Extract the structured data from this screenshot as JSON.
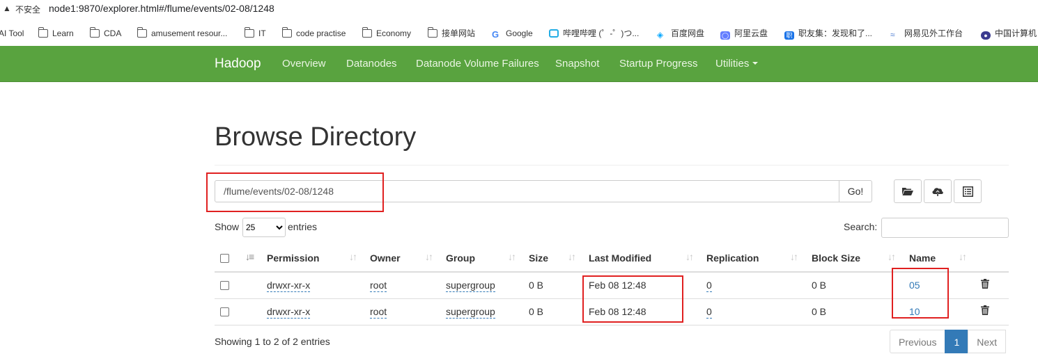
{
  "browser": {
    "warning_label": "不安全",
    "url": "node1:9870/explorer.html#/flume/events/02-08/1248"
  },
  "bookmarks": [
    {
      "label": "AI Tool",
      "icon": "none"
    },
    {
      "label": "Learn",
      "icon": "folder-icon"
    },
    {
      "label": "CDA",
      "icon": "folder-icon"
    },
    {
      "label": "amusement resour...",
      "icon": "folder-icon"
    },
    {
      "label": "IT",
      "icon": "folder-icon"
    },
    {
      "label": "code practise",
      "icon": "folder-icon"
    },
    {
      "label": "Economy",
      "icon": "folder-icon"
    },
    {
      "label": "接单网站",
      "icon": "folder-icon"
    },
    {
      "label": "Google",
      "icon": "google-icon"
    },
    {
      "label": "哔哩哔哩 (゜-゜)つ...",
      "icon": "bilibili-icon"
    },
    {
      "label": "百度网盘",
      "icon": "baidu-pan-icon"
    },
    {
      "label": "阿里云盘",
      "icon": "aliyun-drive-icon"
    },
    {
      "label": "职友集：发现和了...",
      "icon": "zhiyouji-icon"
    },
    {
      "label": "网易见外工作台",
      "icon": "netease-icon"
    },
    {
      "label": "中国计算机",
      "icon": "ccf-icon"
    }
  ],
  "navbar": {
    "brand": "Hadoop",
    "items": [
      "Overview",
      "Datanodes",
      "Datanode Volume Failures",
      "Snapshot",
      "Startup Progress",
      "Utilities"
    ],
    "color": "#59a33f"
  },
  "page": {
    "title": "Browse Directory",
    "path_value": "/flume/events/02-08/1248",
    "go_label": "Go!",
    "show_label": "Show",
    "page_size": "25",
    "entries_label": "entries",
    "search_label": "Search:"
  },
  "table": {
    "headers": [
      "Permission",
      "Owner",
      "Group",
      "Size",
      "Last Modified",
      "Replication",
      "Block Size",
      "Name"
    ],
    "rows": [
      {
        "permission": "drwxr-xr-x",
        "owner": "root",
        "group": "supergroup",
        "size": "0 B",
        "modified": "Feb 08 12:48",
        "replication": "0",
        "block_size": "0 B",
        "name": "05"
      },
      {
        "permission": "drwxr-xr-x",
        "owner": "root",
        "group": "supergroup",
        "size": "0 B",
        "modified": "Feb 08 12:48",
        "replication": "0",
        "block_size": "0 B",
        "name": "10"
      }
    ]
  },
  "footer": {
    "info": "Showing 1 to 2 of 2 entries",
    "pagination": {
      "previous": "Previous",
      "current": "1",
      "next": "Next"
    }
  },
  "colors": {
    "link": "#337ab7",
    "annotation": "#e02020",
    "active_page": "#337ab7"
  }
}
